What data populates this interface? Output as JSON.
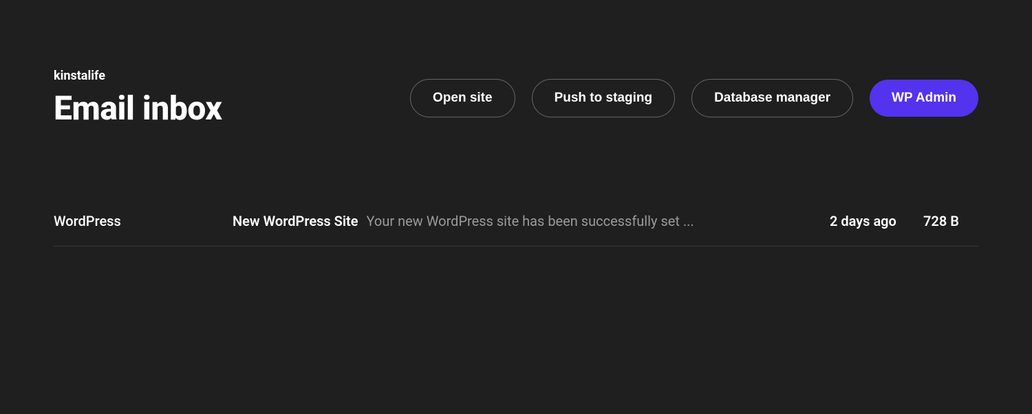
{
  "header": {
    "breadcrumb": "kinstalife",
    "title": "Email inbox",
    "actions": {
      "open_site": "Open site",
      "push_staging": "Push to staging",
      "db_manager": "Database manager",
      "wp_admin": "WP Admin"
    }
  },
  "emails": [
    {
      "sender": "WordPress",
      "subject": "New WordPress Site",
      "preview": "Your new WordPress site has been successfully set ...",
      "time": "2 days ago",
      "size": "728 B"
    }
  ]
}
